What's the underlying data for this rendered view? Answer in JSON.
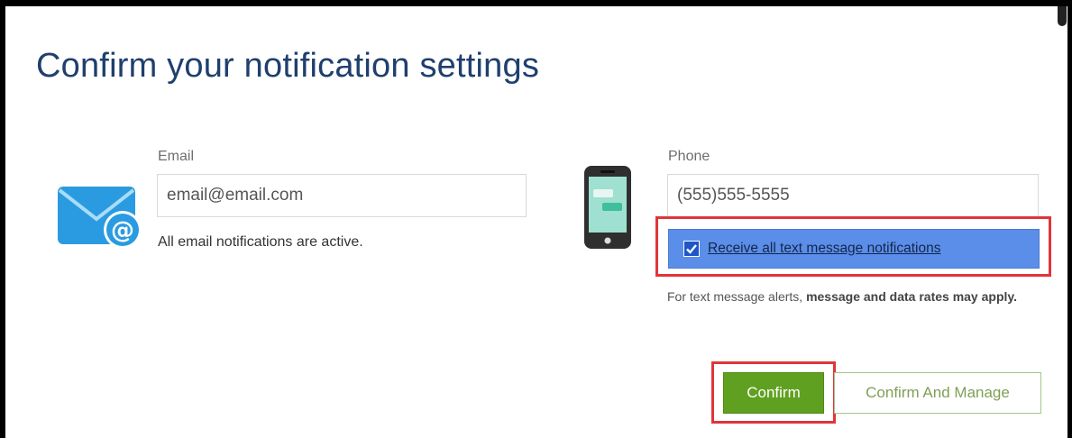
{
  "dialog": {
    "title": "Confirm your notification settings"
  },
  "email": {
    "label": "Email",
    "value": "email@email.com",
    "status_text": "All email notifications are active.",
    "icon": "email-at-icon"
  },
  "phone": {
    "label": "Phone",
    "value": "(555)555-5555",
    "icon": "mobile-phone-icon",
    "sms_checkbox": {
      "label": "Receive all text message notifications",
      "checked": true
    },
    "sms_note_normal": "For text message alerts, ",
    "sms_note_bold": "message and data rates may apply."
  },
  "buttons": {
    "confirm": "Confirm",
    "confirm_and_manage": "Confirm And Manage"
  },
  "colors": {
    "title": "#1f3f6e",
    "checkbox_row_bg": "#5b8ee8",
    "confirm_bg": "#60a020",
    "highlight": "#e0353a"
  }
}
